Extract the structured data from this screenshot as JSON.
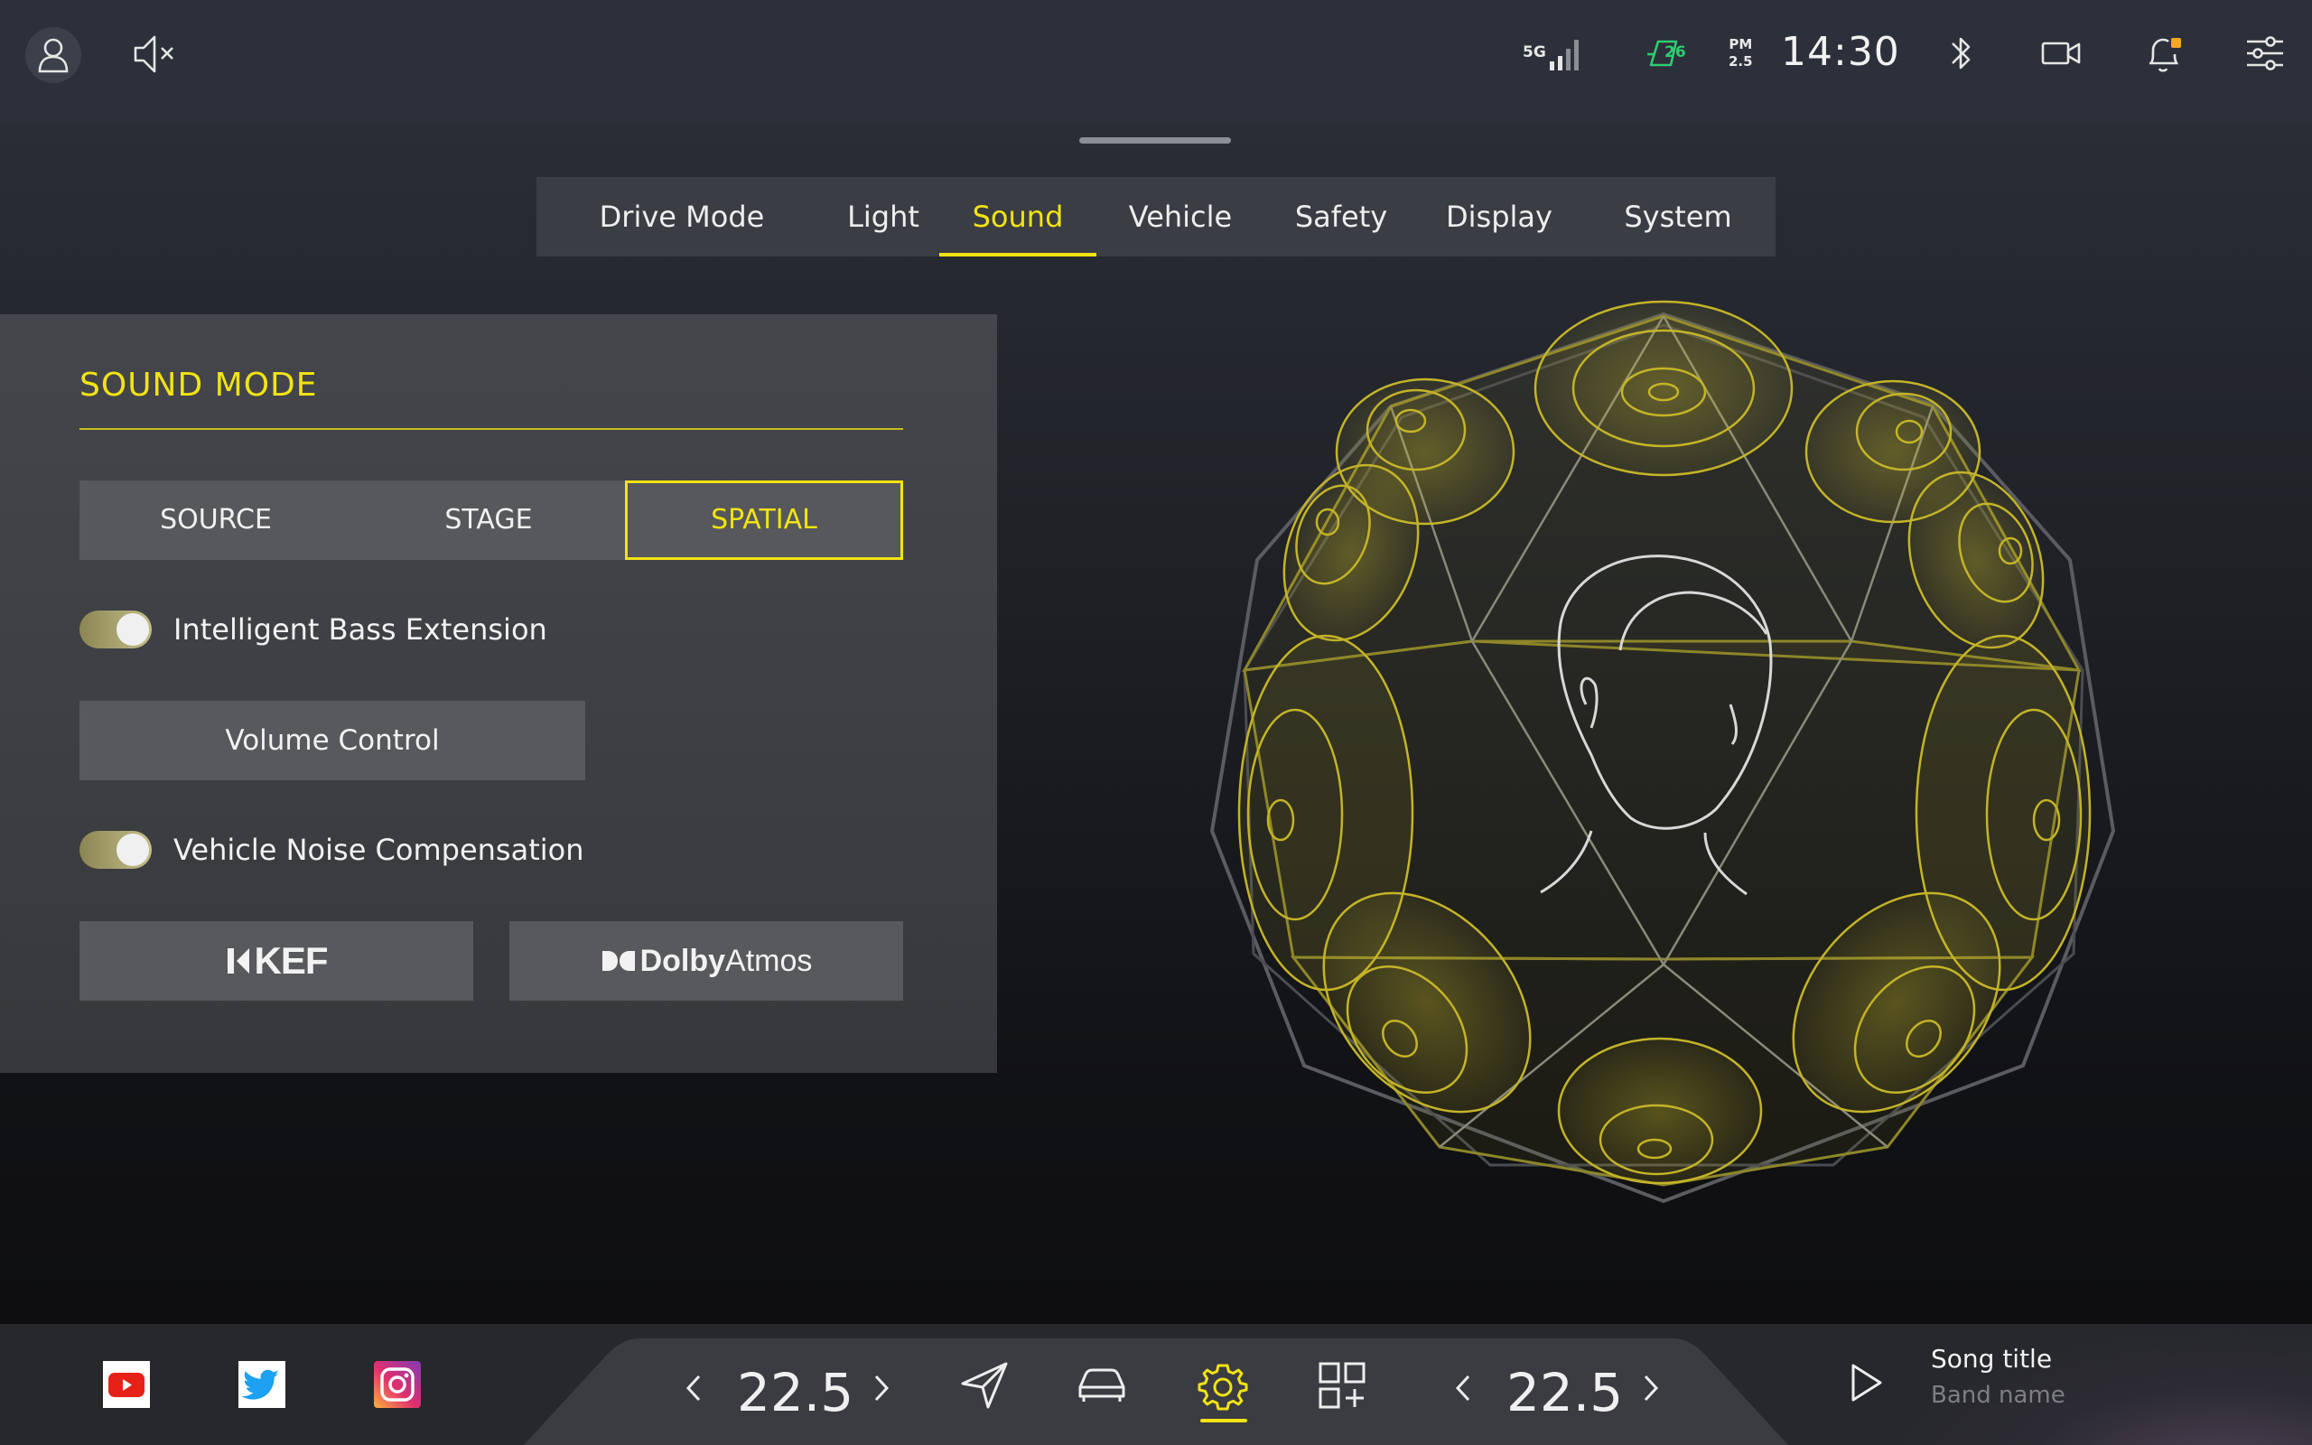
{
  "status": {
    "signal_label": "5G",
    "aqi_value": "26",
    "pm_label": "PM",
    "pm_value": "2.5",
    "time": "14:30",
    "accent_color": "#f2e313",
    "aqi_color": "#2ecc71",
    "notification_dot_color": "#f5a623"
  },
  "tabs": [
    {
      "label": "Drive Mode",
      "active": false
    },
    {
      "label": "Light",
      "active": false
    },
    {
      "label": "Sound",
      "active": true
    },
    {
      "label": "Vehicle",
      "active": false
    },
    {
      "label": "Safety",
      "active": false
    },
    {
      "label": "Display",
      "active": false
    },
    {
      "label": "System",
      "active": false
    }
  ],
  "sound_panel": {
    "title": "SOUND MODE",
    "modes": [
      {
        "label": "SOURCE",
        "active": false
      },
      {
        "label": "STAGE",
        "active": false
      },
      {
        "label": "SPATIAL",
        "active": true
      }
    ],
    "bass_toggle": {
      "label": "Intelligent Bass Extension",
      "on": true
    },
    "volume_button": "Volume Control",
    "noise_toggle": {
      "label": "Vehicle Noise Compensation",
      "on": true
    },
    "kef_label": "KEF",
    "dolby_label_bold": "Dolby",
    "dolby_label_light": "Atmos"
  },
  "climate": {
    "left_temp": "22.5",
    "right_temp": "22.5"
  },
  "dock_icons": [
    "send-icon",
    "car-icon",
    "settings-gear-icon",
    "apps-grid-icon"
  ],
  "apps": [
    "youtube-icon",
    "twitter-icon",
    "instagram-icon"
  ],
  "media": {
    "song_title": "Song title",
    "band_name": "Band name"
  }
}
